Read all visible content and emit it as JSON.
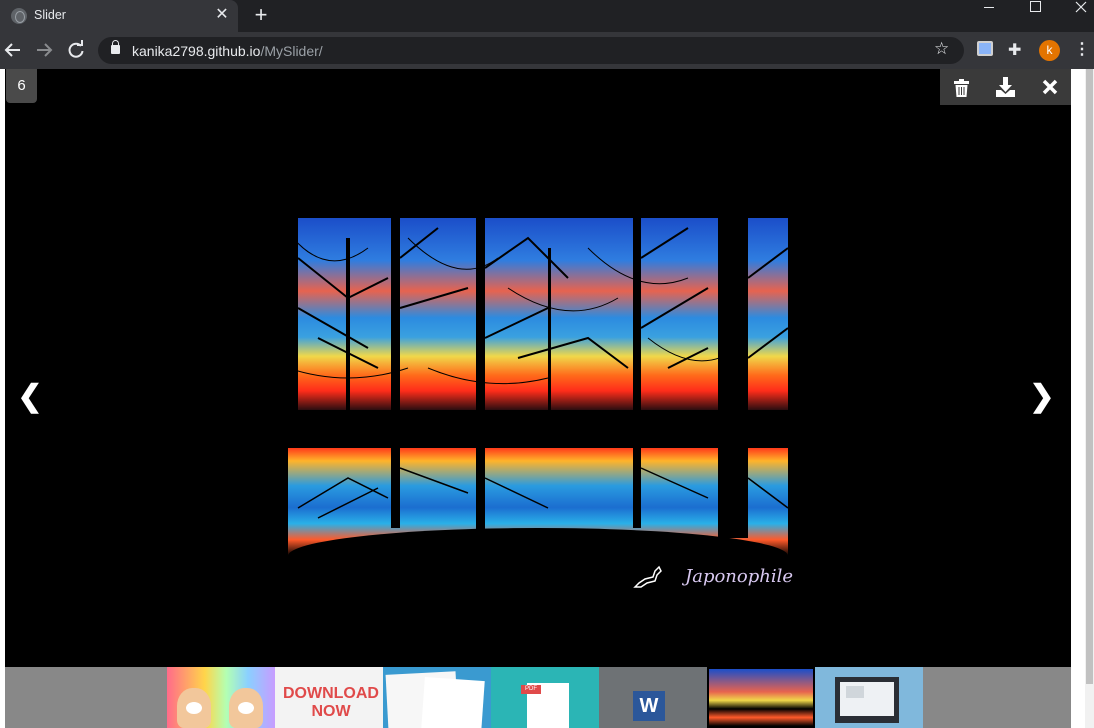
{
  "browser": {
    "tab_title": "Slider",
    "tab_close": "✕",
    "new_tab": "+",
    "url_host": "kanika2798.github.io",
    "url_path": "/MySlider/",
    "profile_initial": "k"
  },
  "viewer": {
    "counter": "6",
    "prev_label": "❮",
    "next_label": "❯",
    "watermark_text": "Japonophile",
    "current_index": 6,
    "total_thumbnails": 7
  },
  "thumbnails": [
    {
      "label": "hamsters"
    },
    {
      "label": "DOWNLOAD NOW"
    },
    {
      "label": "documents"
    },
    {
      "label": "PDF"
    },
    {
      "label": "W"
    },
    {
      "label": "sunset",
      "active": true
    },
    {
      "label": "video-monitor"
    }
  ],
  "colors": {
    "profile": "#e37400",
    "stage": "#000000",
    "thumb_strip": "#888888"
  },
  "icons": [
    "trash-icon",
    "download-icon",
    "close-icon",
    "star-icon",
    "extensions-icon",
    "lock-icon"
  ]
}
